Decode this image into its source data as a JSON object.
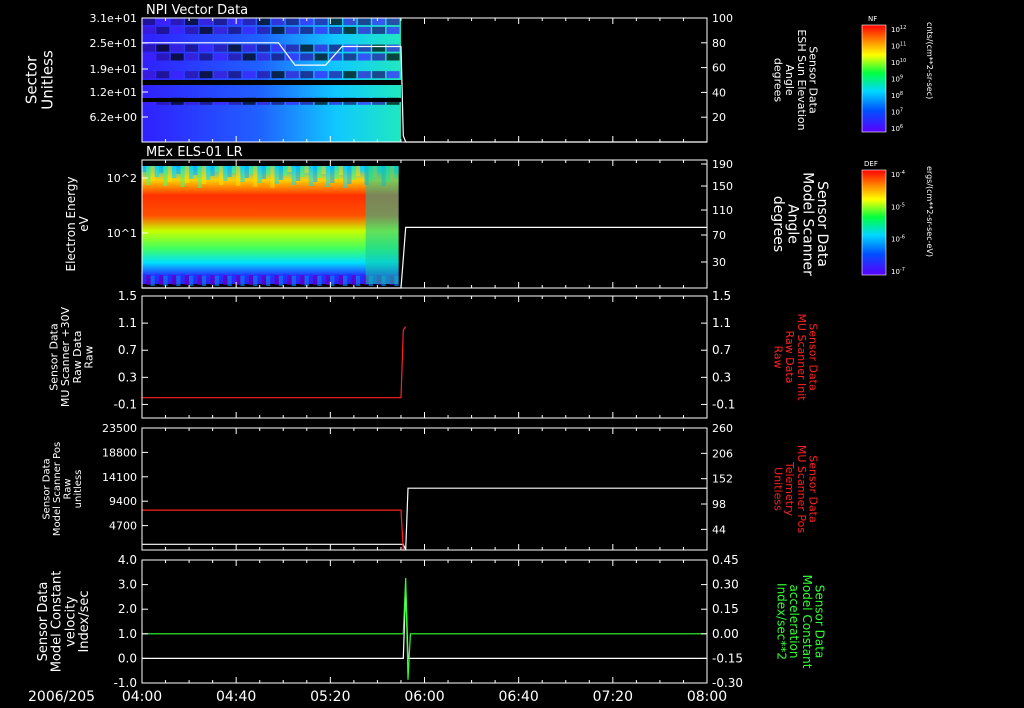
{
  "date_label": "2006/205",
  "time_axis": {
    "ticks": [
      "04:00",
      "04:40",
      "05:20",
      "06:00",
      "06:40",
      "07:20",
      "08:00"
    ],
    "range": [
      "04:00",
      "08:00"
    ]
  },
  "colors": {
    "background": "#000000",
    "axes": "#ffffff",
    "red": "#ff2020",
    "green": "#30ff30",
    "white": "#ffffff"
  },
  "colorbars": [
    {
      "label": "NF",
      "unit": "cnts/(cm**2-sr-sec)",
      "ticks": [
        "10^12",
        "10^11",
        "10^10",
        "10^9",
        "10^8",
        "10^7",
        "10^6"
      ]
    },
    {
      "label": "DEF",
      "unit": "ergs/(cm**2-sr-sec-eV)",
      "ticks": [
        "10^-4",
        "10^-5",
        "10^-6",
        "10^-7"
      ]
    }
  ],
  "chart_data": [
    {
      "type": "heatmap",
      "title": "NPI Vector Data",
      "ylabel_left": [
        "Sector",
        "Unitless"
      ],
      "left_ticks": [
        "3.1e+01",
        "2.5e+01",
        "1.9e+01",
        "1.2e+01",
        "6.2e+00"
      ],
      "ylabel_right": [
        "Sensor Data",
        "ESH Sun Elevation",
        "Angle",
        "degrees"
      ],
      "right_ticks": [
        "100",
        "80",
        "60",
        "40",
        "20"
      ],
      "right_ylim": [
        0,
        100
      ],
      "overlay_series": {
        "name": "ESH Sun Elevation Angle",
        "color": "#ffffff",
        "x": [
          "04:00",
          "04:58",
          "05:05",
          "05:18",
          "05:25",
          "05:50",
          "05:51",
          "05:52",
          "08:00"
        ],
        "y": [
          80,
          80,
          62,
          62,
          77,
          77,
          5,
          0,
          0
        ]
      }
    },
    {
      "type": "heatmap",
      "title": "MEx ELS-01 LR",
      "ylabel_left": [
        "Electron Energy",
        "eV"
      ],
      "left_ticks": [
        "10^2",
        "10^1"
      ],
      "ylabel_right": [
        "Sensor Data",
        "Model Scanner",
        "Angle",
        "degrees"
      ],
      "right_ticks": [
        "190",
        "150",
        "110",
        "70",
        "30"
      ],
      "right_ylim": [
        0,
        190
      ],
      "overlay_series": {
        "name": "Model Scanner Angle",
        "color": "#ffffff",
        "x": [
          "04:00",
          "05:50",
          "05:52",
          "05:53",
          "08:00"
        ],
        "y": [
          0,
          0,
          90,
          90,
          90
        ]
      }
    },
    {
      "type": "line",
      "ylabel_left": [
        "Sensor Data",
        "MU Scanner +30V",
        "Raw Data",
        "Raw"
      ],
      "left_ticks": [
        "1.5",
        "1.1",
        "0.7",
        "0.3",
        "-0.1"
      ],
      "ylim": [
        -0.3,
        1.5
      ],
      "ylabel_right": [
        "Sensor Data",
        "MU Scanner Init",
        "Raw Data",
        "Raw"
      ],
      "right_ticks": [
        "1.5",
        "1.1",
        "0.7",
        "0.3",
        "-0.1"
      ],
      "series": [
        {
          "name": "MU Scanner Init",
          "color": "#ff2020",
          "x": [
            "04:00",
            "05:50",
            "05:51",
            "05:52"
          ],
          "y": [
            0.0,
            0.0,
            1.0,
            1.05
          ]
        }
      ]
    },
    {
      "type": "line",
      "ylabel_left": [
        "Sensor Data",
        "Model Scanner Pos",
        "Raw",
        "unitless"
      ],
      "left_ticks": [
        "23500",
        "18800",
        "14100",
        "9400",
        "4700"
      ],
      "ylim": [
        0,
        23500
      ],
      "ylabel_right": [
        "Sensor Data",
        "MU Scanner Pos",
        "Telemetry",
        "Unitless"
      ],
      "right_ticks": [
        "260",
        "206",
        "152",
        "98",
        "44"
      ],
      "right_ylim": [
        0,
        260
      ],
      "series": [
        {
          "name": "Model Scanner Pos",
          "color": "#ffffff",
          "axis": "left",
          "x": [
            "04:00",
            "05:51",
            "05:52",
            "05:53",
            "08:00"
          ],
          "y": [
            1100,
            1100,
            0,
            11900,
            11900
          ]
        },
        {
          "name": "MU Scanner Pos",
          "color": "#ff2020",
          "axis": "right",
          "x": [
            "04:00",
            "05:50",
            "05:51",
            "05:52"
          ],
          "y": [
            85,
            85,
            0,
            0
          ]
        }
      ]
    },
    {
      "type": "line",
      "ylabel_left": [
        "Sensor Data",
        "Model Constant",
        "velocity",
        "Index/sec"
      ],
      "left_ticks": [
        "4.0",
        "3.0",
        "2.0",
        "1.0",
        "0.0",
        "-1.0"
      ],
      "ylim": [
        -1,
        4
      ],
      "ylabel_right": [
        "Sensor Data",
        "Model Constant",
        "acceleration",
        "Index/sec**2"
      ],
      "right_ticks": [
        "0.45",
        "0.30",
        "0.15",
        "0.00",
        "-0.15",
        "-0.30"
      ],
      "right_ylim": [
        -0.3,
        0.45
      ],
      "series": [
        {
          "name": "Model Constant velocity",
          "color": "#ffffff",
          "axis": "left",
          "x": [
            "04:00",
            "05:51",
            "05:52",
            "05:53",
            "08:00"
          ],
          "y": [
            0,
            0,
            3.0,
            0,
            0
          ]
        },
        {
          "name": "Model Constant acceleration",
          "color": "#30ff30",
          "axis": "right",
          "x": [
            "04:00",
            "05:51",
            "05:52",
            "05:53",
            "05:54",
            "08:00"
          ],
          "y": [
            0,
            0,
            0.34,
            -0.28,
            0,
            0
          ]
        }
      ]
    }
  ]
}
